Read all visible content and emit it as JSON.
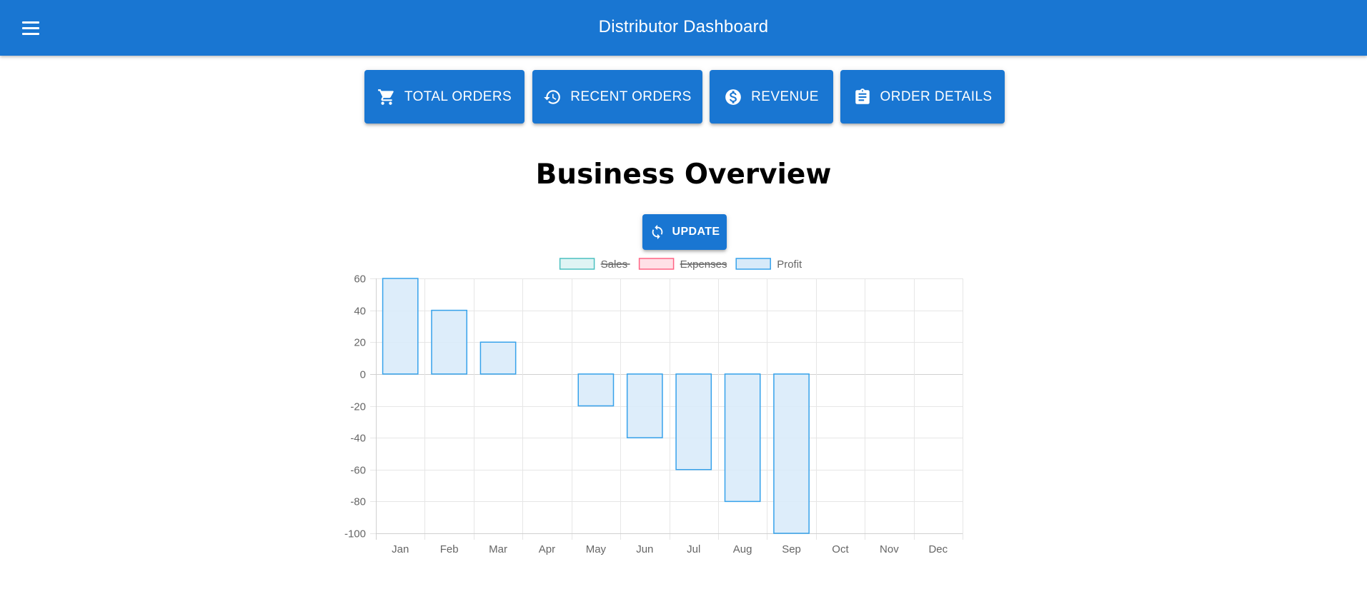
{
  "appbar": {
    "title": "Distributor Dashboard",
    "menu_icon": "menu-icon"
  },
  "nav_buttons": [
    {
      "label": "TOTAL ORDERS",
      "icon": "shopping-cart-icon"
    },
    {
      "label": "RECENT ORDERS",
      "icon": "history-icon"
    },
    {
      "label": "REVENUE",
      "icon": "dollar-circle-icon"
    },
    {
      "label": "ORDER DETAILS",
      "icon": "clipboard-icon"
    }
  ],
  "page_title": "Business Overview",
  "update_button": {
    "label": "UPDATE",
    "icon": "refresh-icon"
  },
  "colors": {
    "primary": "#1976d2",
    "sales_fill": "#dff4f4",
    "sales_border": "#4bc0c0",
    "expenses_fill": "#ffe0e6",
    "expenses_border": "#ff6384",
    "profit_fill": "#d7eaf9",
    "profit_border": "#36a2eb"
  },
  "chart_data": {
    "type": "bar",
    "categories": [
      "Jan",
      "Feb",
      "Mar",
      "Apr",
      "May",
      "Jun",
      "Jul",
      "Aug",
      "Sep",
      "Oct",
      "Nov",
      "Dec"
    ],
    "series": [
      {
        "name": "Sales",
        "hidden": true,
        "values": []
      },
      {
        "name": "Expenses",
        "hidden": true,
        "values": []
      },
      {
        "name": "Profit",
        "hidden": false,
        "values": [
          60,
          40,
          20,
          0,
          -20,
          -40,
          -60,
          -80,
          -100,
          null,
          null,
          null
        ]
      }
    ],
    "ylim": [
      -100,
      60
    ],
    "yticks": [
      60,
      40,
      20,
      0,
      -20,
      -40,
      -60,
      -80,
      -100
    ],
    "grid": true,
    "legend_position": "top"
  }
}
